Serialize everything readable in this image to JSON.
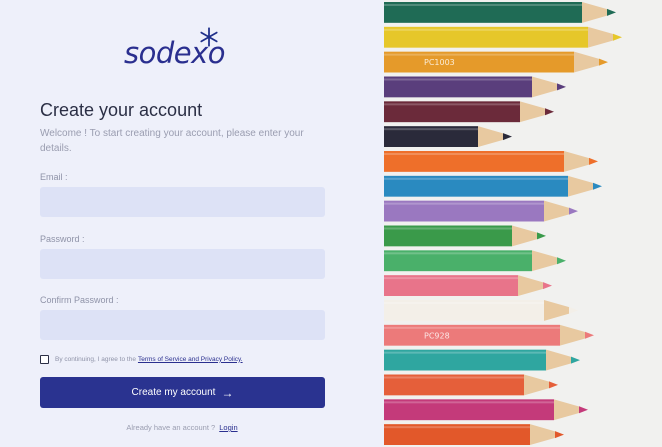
{
  "brand": {
    "name": "sodexo",
    "accent": "#2a3390",
    "star_color": "#1f2f8a"
  },
  "form": {
    "title": "Create your account",
    "subtitle": "Welcome ! To start creating your account, please enter your details.",
    "email_label": "Email :",
    "email_value": "",
    "password_label": "Password :",
    "password_value": "",
    "confirm_label": "Confirm Password :",
    "confirm_value": "",
    "terms_text": "By continuing, I agree to the",
    "terms_link": "Terms of Service and Privacy Policy.",
    "terms_checked": false,
    "submit_label": "Create my account",
    "submit_icon": "arrow-right-icon",
    "already_text": "Already have an account ?",
    "login_link": "Login"
  },
  "image": {
    "subject": "colored-pencils-photo",
    "pencils": [
      {
        "color": "#1f6b55",
        "text": ""
      },
      {
        "color": "#e6c72a",
        "text": ""
      },
      {
        "color": "#e59a2a",
        "text": "PC1003"
      },
      {
        "color": "#5a3e7c",
        "text": ""
      },
      {
        "color": "#6b2a3a",
        "text": ""
      },
      {
        "color": "#2a2a3a",
        "text": ""
      },
      {
        "color": "#ee6f2a",
        "text": ""
      },
      {
        "color": "#2a8ac0",
        "text": ""
      },
      {
        "color": "#9a78c0",
        "text": ""
      },
      {
        "color": "#3a9a4a",
        "text": ""
      },
      {
        "color": "#4ab06a",
        "text": ""
      },
      {
        "color": "#e8748a",
        "text": ""
      },
      {
        "color": "#f3efe8",
        "text": ""
      },
      {
        "color": "#ec7a7a",
        "text": "PC928"
      },
      {
        "color": "#2fa6a0",
        "text": ""
      },
      {
        "color": "#e55f3a",
        "text": ""
      },
      {
        "color": "#c43a7a",
        "text": ""
      },
      {
        "color": "#e2582a",
        "text": ""
      }
    ]
  }
}
